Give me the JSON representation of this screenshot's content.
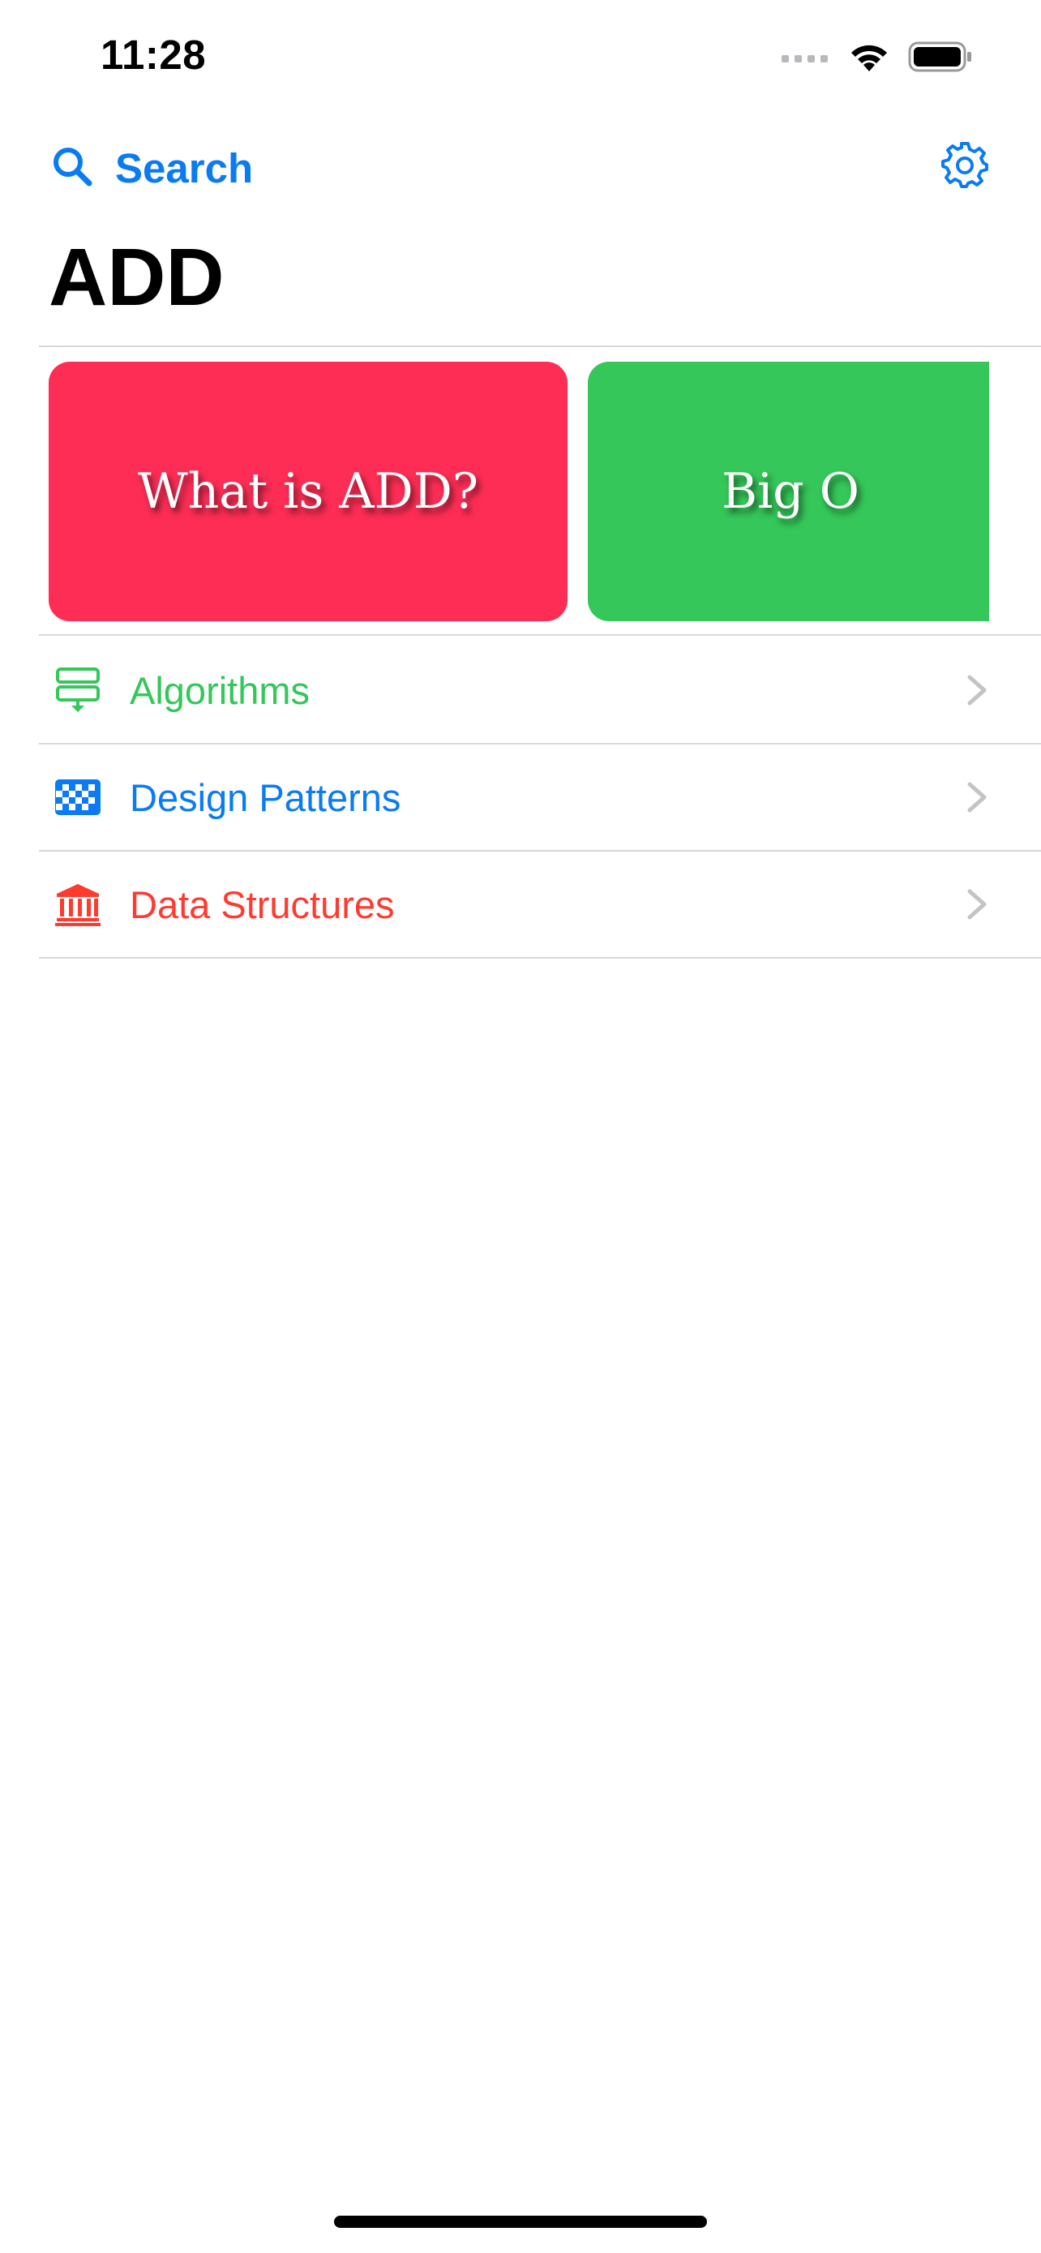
{
  "status_bar": {
    "time": "11:28"
  },
  "nav": {
    "search_label": "Search",
    "search_icon": "magnifying-glass-icon",
    "settings_icon": "gear-icon"
  },
  "page": {
    "title": "ADD"
  },
  "cards": [
    {
      "label": "What is ADD?",
      "color": "#fe2d55"
    },
    {
      "label": "Big O",
      "color": "#35c759"
    }
  ],
  "list": [
    {
      "label": "Algorithms",
      "icon": "flowchart-icon",
      "color": "#34c759"
    },
    {
      "label": "Design Patterns",
      "icon": "checkerboard-icon",
      "color": "#0a7bf2"
    },
    {
      "label": "Data Structures",
      "icon": "building-columns-icon",
      "color": "#ff3b30"
    }
  ],
  "colors": {
    "accent": "#0a7bf2",
    "divider": "#d8d8dc",
    "chevron": "#c4c4c7"
  }
}
